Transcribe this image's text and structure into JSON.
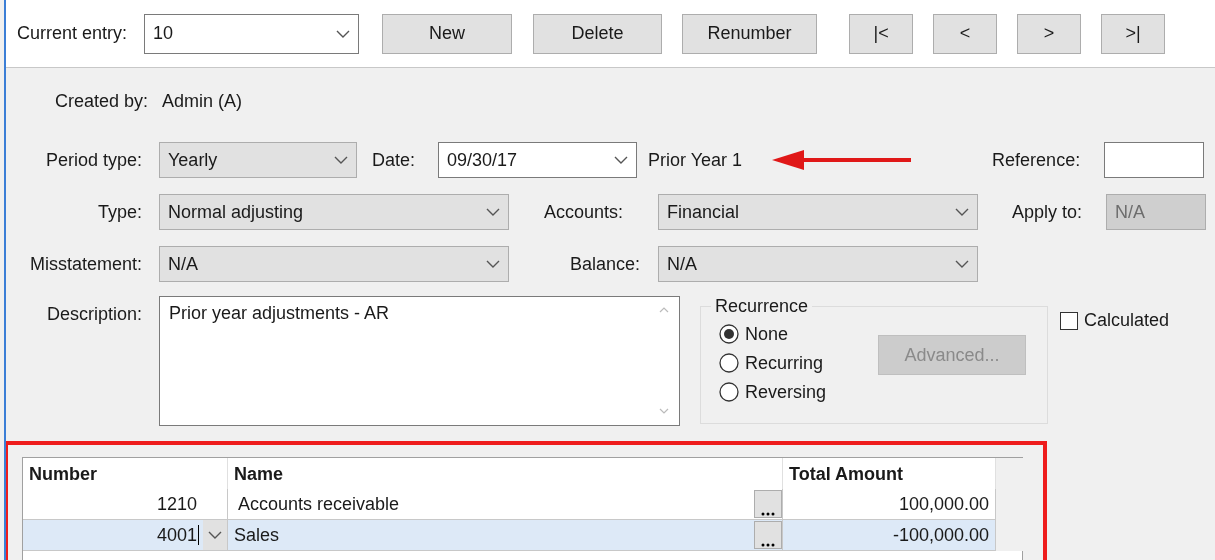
{
  "toolbar": {
    "current_entry_label": "Current entry:",
    "current_entry": "10",
    "buttons": [
      "New",
      "Delete",
      "Renumber"
    ],
    "nav_buttons": [
      "|<",
      "<",
      ">",
      ">|"
    ]
  },
  "created_by": {
    "label": "Created by:",
    "value": "Admin (A)"
  },
  "period_row": {
    "period_type_label": "Period type:",
    "period_type": "Yearly",
    "date_label": "Date:",
    "date": "09/30/17",
    "period_name": "Prior Year 1",
    "reference_label": "Reference:"
  },
  "type_row": {
    "type_label": "Type:",
    "type": "Normal adjusting",
    "accounts_label": "Accounts:",
    "accounts": "Financial",
    "apply_to_label": "Apply to:",
    "apply_to": "N/A",
    "apply_to_disabled": true
  },
  "misstatement_row": {
    "misstatement_label": "Misstatement:",
    "misstatement": "N/A",
    "balance_label": "Balance:",
    "balance": "N/A"
  },
  "description": {
    "label": "Description:",
    "value": "Prior year adjustments - AR"
  },
  "recurrence": {
    "title": "Recurrence",
    "options": [
      {
        "label": "None",
        "selected": true
      },
      {
        "label": "Recurring",
        "selected": false
      },
      {
        "label": "Reversing",
        "selected": false
      }
    ],
    "advanced_button": "Advanced...",
    "advanced_disabled": true
  },
  "calculated": {
    "label": "Calculated",
    "checked": false
  },
  "grid": {
    "columns": [
      "Number",
      "Name",
      "Total Amount"
    ],
    "rows": [
      {
        "number": "1210",
        "name": "Accounts receivable",
        "total_amount": "100,000.00",
        "selected": false
      },
      {
        "number": "4001",
        "name": "Sales",
        "total_amount": "-100,000.00",
        "selected": true
      }
    ]
  }
}
